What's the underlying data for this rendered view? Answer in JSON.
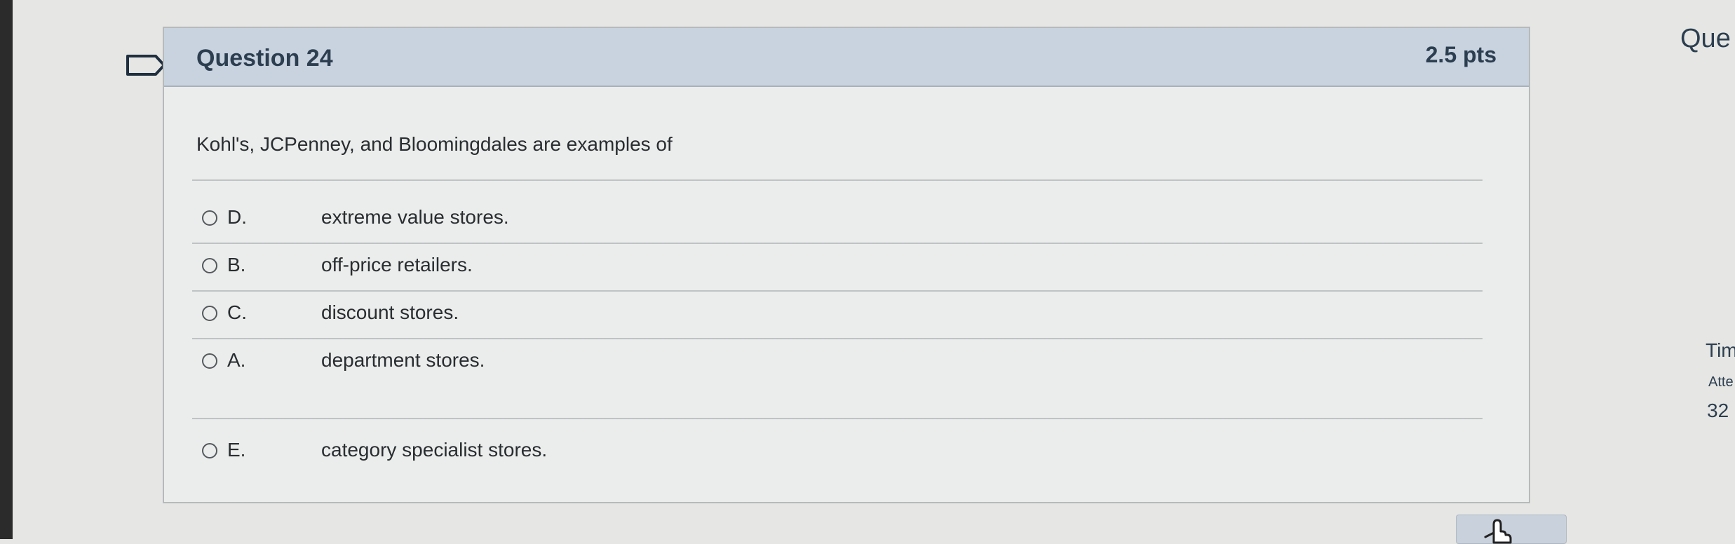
{
  "question": {
    "title": "Question 24",
    "points": "2.5 pts",
    "prompt": "Kohl's, JCPenney, and Bloomingdales are examples of",
    "answers": [
      {
        "letter": "D.",
        "text": "extreme value stores."
      },
      {
        "letter": "B.",
        "text": "off-price retailers."
      },
      {
        "letter": "C.",
        "text": "discount stores."
      },
      {
        "letter": "A.",
        "text": "department stores."
      },
      {
        "letter": "E.",
        "text": "category specialist stores."
      }
    ]
  },
  "sidebar": {
    "title_partial": "Que",
    "time_partial": "Tim",
    "attempt_partial": "Atte",
    "value_partial": "32"
  },
  "icons": {
    "flag": "flag-icon",
    "radio": "radio-button",
    "cursor": "hand-pointer-icon"
  }
}
